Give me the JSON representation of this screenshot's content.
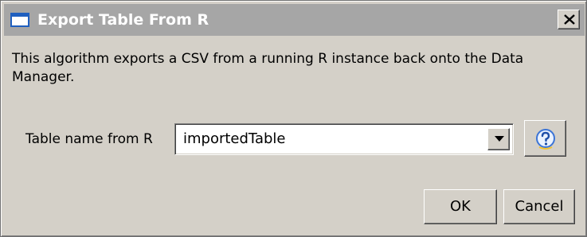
{
  "window": {
    "title": "Export Table From R",
    "close_label": "close"
  },
  "description": "This algorithm exports a CSV from a running R instance back onto the Data Manager.",
  "form": {
    "table_name_label": "Table name from R",
    "table_name_value": "importedTable"
  },
  "buttons": {
    "ok_label": "OK",
    "cancel_label": "Cancel"
  },
  "icons": {
    "window": "window-icon",
    "close": "close-icon",
    "dropdown": "chevron-down-icon",
    "help": "help-icon"
  },
  "colors": {
    "titlebar_inactive": "#a6a6a6",
    "dialog_bg": "#d4d0c8",
    "help_blue": "#3b74d6"
  }
}
